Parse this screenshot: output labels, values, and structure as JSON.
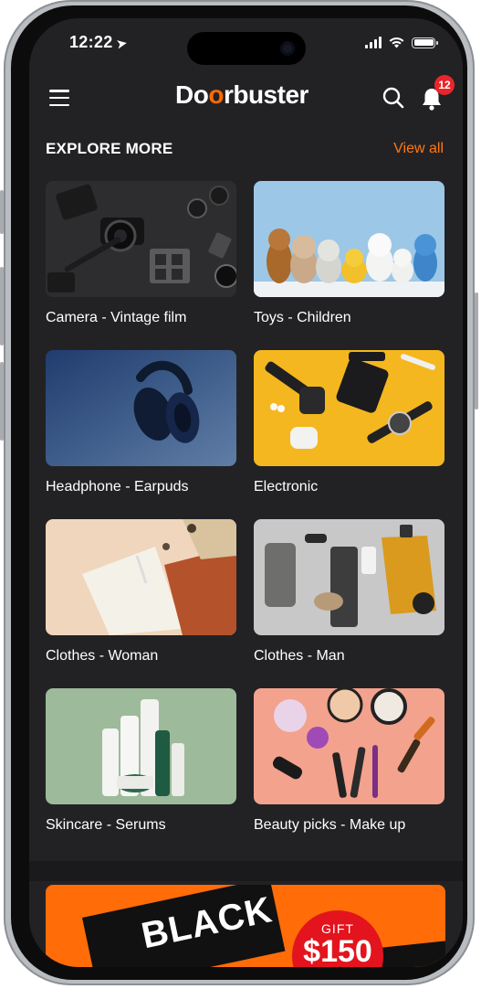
{
  "status_bar": {
    "time": "12:22"
  },
  "header": {
    "logo_prefix": "Do",
    "logo_o": "o",
    "logo_suffix": "rbuster",
    "notification_count": "12"
  },
  "section": {
    "title": "EXPLORE MORE",
    "view_all": "View all"
  },
  "categories": [
    {
      "label": "Camera - Vintage film"
    },
    {
      "label": "Toys - Children"
    },
    {
      "label": "Headphone - Earpuds"
    },
    {
      "label": "Electronic"
    },
    {
      "label": "Clothes - Woman"
    },
    {
      "label": "Clothes - Man"
    },
    {
      "label": "Skincare - Serums"
    },
    {
      "label": "Beauty picks - Make up"
    }
  ],
  "banner": {
    "black_text": "BLACK",
    "gift_label": "GIFT",
    "gift_amount": "$150"
  },
  "colors": {
    "accent": "#ff6a00",
    "background": "#222225",
    "badge": "#e8262b"
  }
}
